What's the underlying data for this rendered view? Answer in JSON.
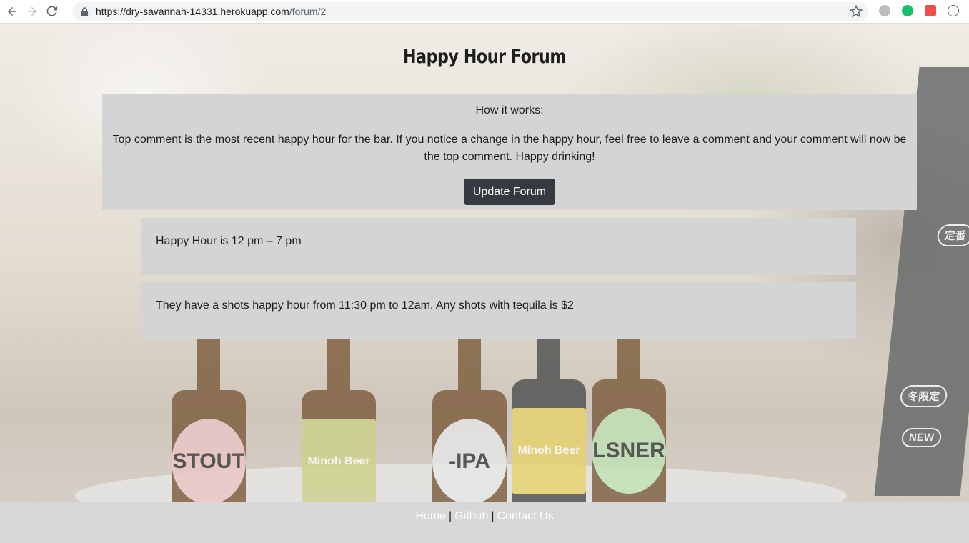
{
  "browser": {
    "url_domain": "https://dry-savannah-14331.herokuapp.com",
    "url_path": "/forum/2",
    "icons": [
      "back-icon",
      "forward-icon",
      "reload-icon",
      "lock-icon",
      "star-icon"
    ],
    "extension_colors": [
      "#bdbdbd",
      "#15c26b",
      "#f24d4d",
      "#5f6368"
    ]
  },
  "page": {
    "title": "Happy Hour Forum",
    "how_it_works": {
      "heading": "How it works:",
      "text": "Top comment is the most recent happy hour for the bar. If you notice a change in the happy hour, feel free to leave a comment and your comment will now be the top comment. Happy drinking!",
      "button_label": "Update Forum",
      "button_color": "#343a40"
    },
    "comments": [
      {
        "text": "Happy Hour is 12 pm – 7 pm"
      },
      {
        "text": "They have a shots happy hour from 11:30 pm to 12am. Any shots with tequila is $2"
      }
    ],
    "background_labels": [
      "STOUT",
      "Minoh Beer",
      "-IPA",
      "Minoh Beer",
      "LSNER",
      "冬限定",
      "NEW",
      "定番"
    ]
  },
  "footer": {
    "links": [
      "Home",
      "Github",
      "Contact Us"
    ],
    "separator": "|"
  }
}
